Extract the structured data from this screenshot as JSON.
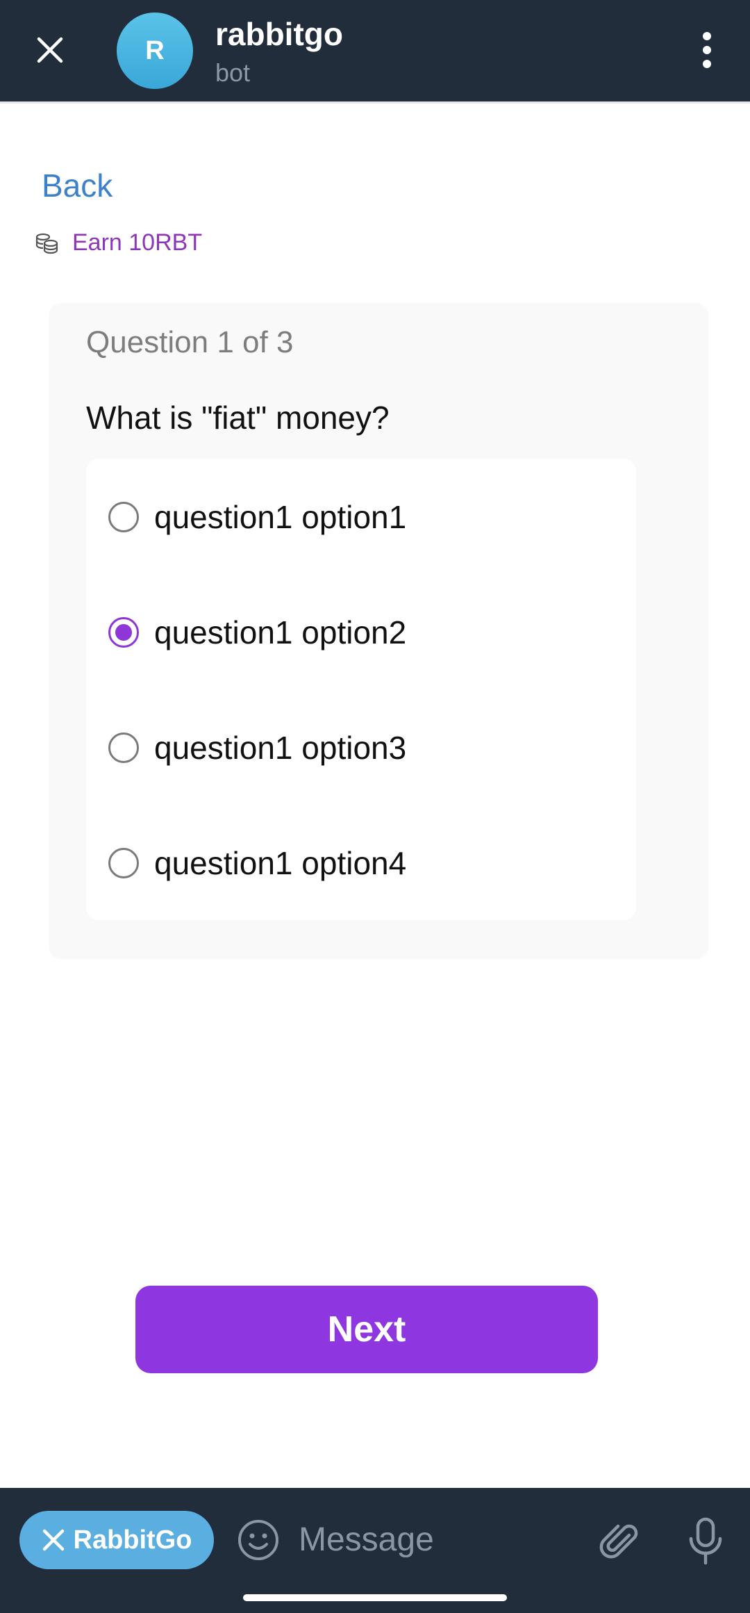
{
  "header": {
    "avatar_letter": "R",
    "title": "rabbitgo",
    "subtitle": "bot",
    "close_icon": "close-icon",
    "menu_icon": "more-vertical-icon"
  },
  "content": {
    "back_label": "Back",
    "earn_icon": "coins-icon",
    "earn_label": "Earn 10RBT",
    "question_counter": "Question 1 of 3",
    "question_text": "What is \"fiat\" money?",
    "options": [
      {
        "label": "question1 option1",
        "selected": false
      },
      {
        "label": "question1 option2",
        "selected": true
      },
      {
        "label": "question1 option3",
        "selected": false
      },
      {
        "label": "question1 option4",
        "selected": false
      }
    ],
    "next_label": "Next"
  },
  "input_bar": {
    "bot_chip_label": "RabbitGo",
    "message_placeholder": "Message",
    "emoji_icon": "smile-icon",
    "attach_icon": "paperclip-icon",
    "mic_icon": "microphone-icon"
  },
  "colors": {
    "header_bg": "#212d3b",
    "accent_purple": "#8e36e0",
    "link_blue": "#3d82c8",
    "earn_purple": "#8e36b8",
    "chip_blue": "#5aaee0"
  }
}
